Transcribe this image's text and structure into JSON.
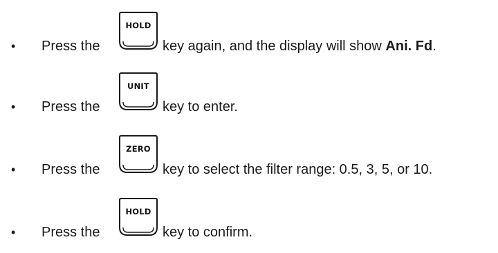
{
  "steps": [
    {
      "bullet": "•",
      "before": "Press the",
      "key": "HOLD",
      "after": "key again, and the display will show",
      "emphasis": "Ani. Fd",
      "end": "."
    },
    {
      "bullet": "•",
      "before": "Press the",
      "key": "UNIT",
      "after": "key to enter."
    },
    {
      "bullet": "•",
      "before": "Press the",
      "key": "ZERO",
      "after": "key to select the filter range: 0.5, 3, 5, or 10."
    },
    {
      "bullet": "•",
      "before": "Press the",
      "key": "HOLD",
      "after": "key to confirm."
    }
  ]
}
